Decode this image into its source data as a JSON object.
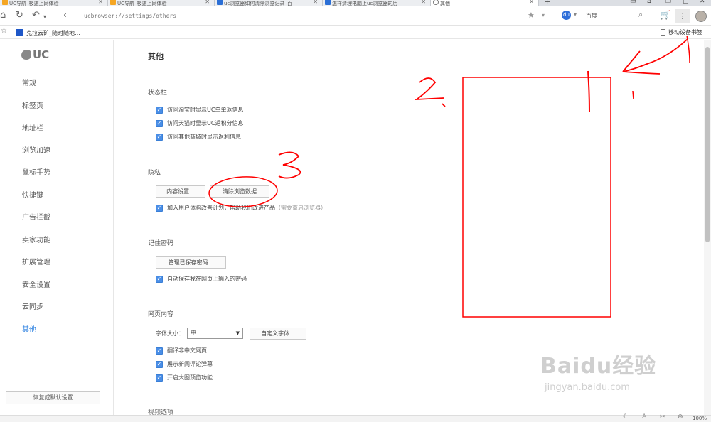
{
  "tabs": [
    {
      "title": "UC导航_极速上网体验"
    },
    {
      "title": "UC导航_极速上网体验"
    },
    {
      "title": "uc浏览器如何清除浏览记录_百"
    },
    {
      "title": "怎样清理电脑上uc浏览器的历"
    },
    {
      "title": "其他"
    }
  ],
  "address_bar": {
    "url": "ucbrowser://settings/others",
    "search_engine": "百度"
  },
  "bookmarks": {
    "item_label": "克拉云矿_随时随地…",
    "mobile_bookmarks": "移动设备书签"
  },
  "sidebar": {
    "logo_text": "UC",
    "items": [
      {
        "label": "常规"
      },
      {
        "label": "标签页"
      },
      {
        "label": "地址栏"
      },
      {
        "label": "浏览加速"
      },
      {
        "label": "鼠标手势"
      },
      {
        "label": "快捷键"
      },
      {
        "label": "广告拦截"
      },
      {
        "label": "卖家功能"
      },
      {
        "label": "扩展管理"
      },
      {
        "label": "安全设置"
      },
      {
        "label": "云同步"
      },
      {
        "label": "其他"
      }
    ],
    "active_item": "其他",
    "reset_button": "恢复成默认设置"
  },
  "main": {
    "title": "其他",
    "status_bar_section": {
      "heading": "状态栏",
      "options": [
        {
          "label": "访问淘宝时显示UC单单返信息",
          "checked": true
        },
        {
          "label": "访问天猫时显示UC返积分信息",
          "checked": true
        },
        {
          "label": "访问其他商城时显示返利信息",
          "checked": true
        }
      ]
    },
    "privacy_section": {
      "heading": "隐私",
      "content_settings_button": "内容设置...",
      "clear_data_button": "清除浏览数据",
      "ux_program_label": "加入用户体验改善计划，帮助我们改进产品",
      "ux_program_hint": "（需要重启浏览器）",
      "ux_program_checked": true
    },
    "password_section": {
      "heading": "记住密码",
      "manage_button": "管理已保存密码...",
      "autosave_label": "自动保存我在网页上输入的密码",
      "autosave_checked": true
    },
    "web_content_section": {
      "heading": "网页内容",
      "font_size_label": "字体大小：",
      "font_size_value": "中",
      "custom_font_button": "自定义字体...",
      "options": [
        {
          "label": "翻译非中文网页",
          "checked": true
        },
        {
          "label": "展示新闻评论弹幕",
          "checked": true
        },
        {
          "label": "开启大图预览功能",
          "checked": true
        }
      ]
    },
    "video_section": {
      "heading": "视频选项"
    }
  },
  "status_bar": {
    "zoom": "100%"
  },
  "annotations": {
    "color": "#ff0000",
    "labels": [
      "1",
      "2",
      "3"
    ]
  },
  "watermark": {
    "logo": "Baidu经验",
    "url": "jingyan.baidu.com"
  },
  "colors": {
    "accent": "#2a7fe0",
    "checkbox": "#4a8ee6"
  }
}
